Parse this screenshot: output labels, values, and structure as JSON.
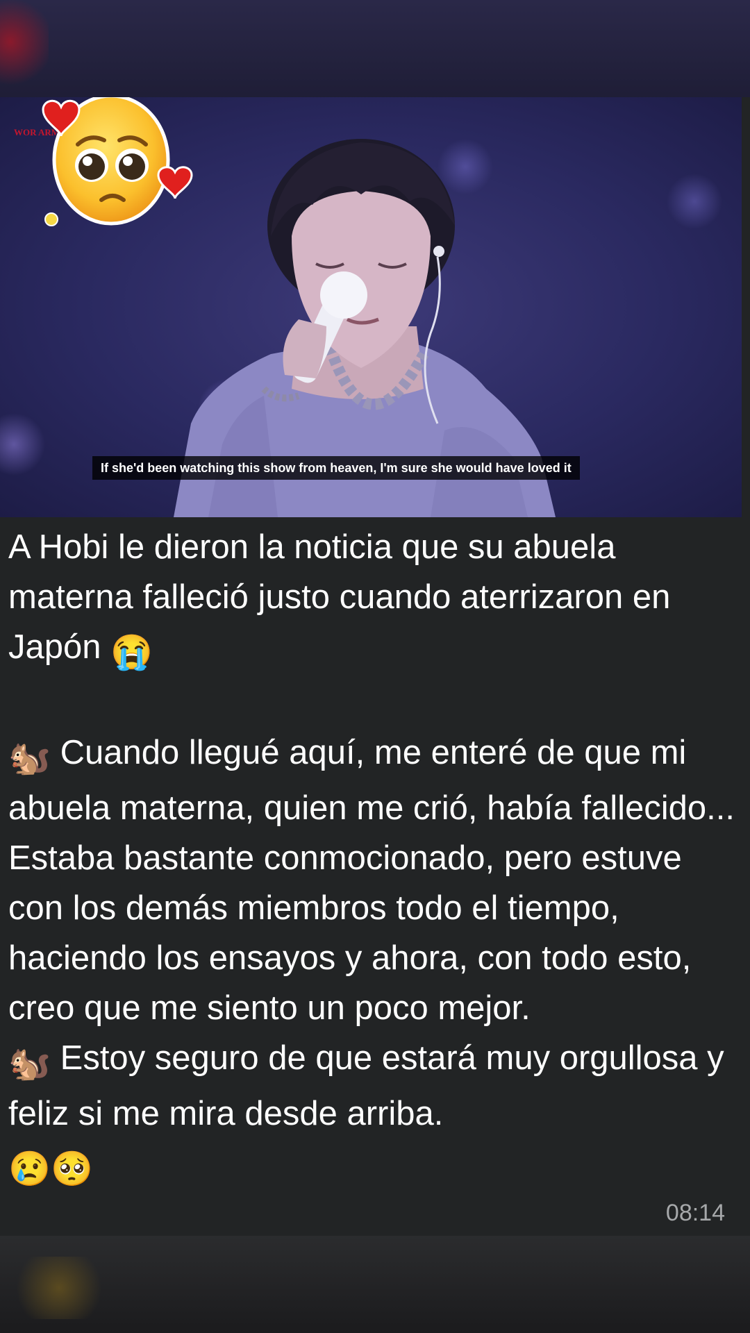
{
  "media": {
    "subtitle": "If she'd been watching this show from heaven, I'm sure she would have loved it",
    "sticker_emoji": "🥺",
    "sticker_decor": [
      "heart",
      "heart"
    ],
    "watermark_text": "WOR ARM"
  },
  "message": {
    "line1": "A Hobi le dieron la noticia que su abuela materna falleció justo cuando aterrizaron en Japón",
    "line1_emoji": "😭",
    "quote1_emoji": "🐿️",
    "quote1": "Cuando llegué aquí, me enteré de que mi abuela materna, quien me crió, había fallecido... Estaba bastante conmocionado, pero estuve con los demás miembros todo el tiempo, haciendo los ensayos y ahora, con todo esto, creo que me siento un poco mejor.",
    "quote2_emoji": "🐿️",
    "quote2": "Estoy seguro de que estará muy orgullosa y feliz si me mira desde arriba.",
    "end_emojis": "😢🥺",
    "timestamp": "08:14"
  },
  "colors": {
    "bubble": "#222425",
    "text": "#ffffff",
    "timestamp": "#a6a8aa"
  }
}
